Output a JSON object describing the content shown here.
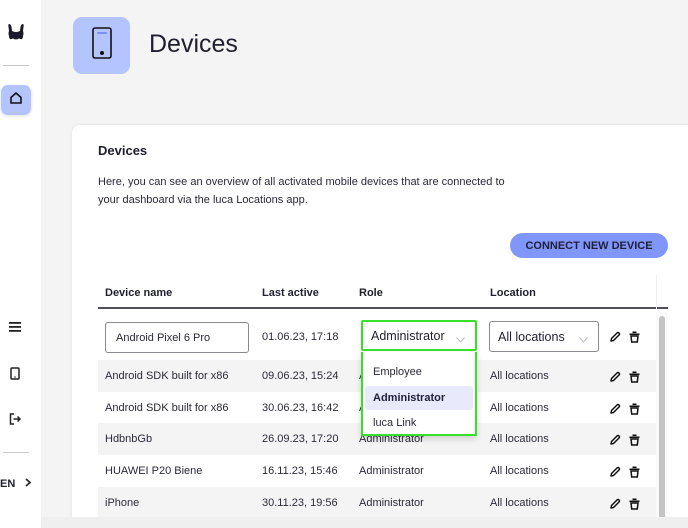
{
  "sidebar": {
    "logo": "luca-logo-icon",
    "items": [
      {
        "name": "home",
        "icon": "home-icon",
        "active": true
      },
      {
        "name": "menu",
        "icon": "menu-icon",
        "active": false
      },
      {
        "name": "devices",
        "icon": "device-icon",
        "active": false
      },
      {
        "name": "logout",
        "icon": "logout-icon",
        "active": false
      }
    ],
    "language": "EN"
  },
  "header": {
    "icon": "mobile-device-icon",
    "title": "Devices"
  },
  "card": {
    "title": "Devices",
    "description": "Here, you can see an overview of all activated mobile devices that are connected to your dashboard via the luca Locations app.",
    "connect_button": "CONNECT NEW DEVICE"
  },
  "table": {
    "columns": [
      "Device name",
      "Last active",
      "Role",
      "Location"
    ],
    "editing_row": {
      "name_value": "Android Pixel 6 Pro",
      "last_active": "01.06.23, 17:18",
      "role_value": "Administrator",
      "location_value": "All locations"
    },
    "rows": [
      {
        "name": "Android SDK built for x86",
        "last_active": "09.06.23, 15:24",
        "role": "Administrator",
        "location": "All locations"
      },
      {
        "name": "Android SDK built for x86",
        "last_active": "30.06.23, 16:42",
        "role": "Administrator",
        "location": "All locations"
      },
      {
        "name": "HdbnbGb",
        "last_active": "26.09.23, 17:20",
        "role": "Administrator",
        "location": "All locations"
      },
      {
        "name": "HUAWEI P20 Biene",
        "last_active": "16.11.23, 15:46",
        "role": "Administrator",
        "location": "All locations"
      },
      {
        "name": "iPhone",
        "last_active": "30.11.23, 19:56",
        "role": "Administrator",
        "location": "All locations"
      }
    ]
  },
  "role_dropdown": {
    "options": [
      "Employee",
      "Administrator",
      "luca Link"
    ],
    "selected": "Administrator"
  },
  "colors": {
    "accent": "#8196fb",
    "accent_light": "#b4c4ff",
    "focus_outline": "#39e029",
    "selected_option_bg": "#e8eafc"
  }
}
